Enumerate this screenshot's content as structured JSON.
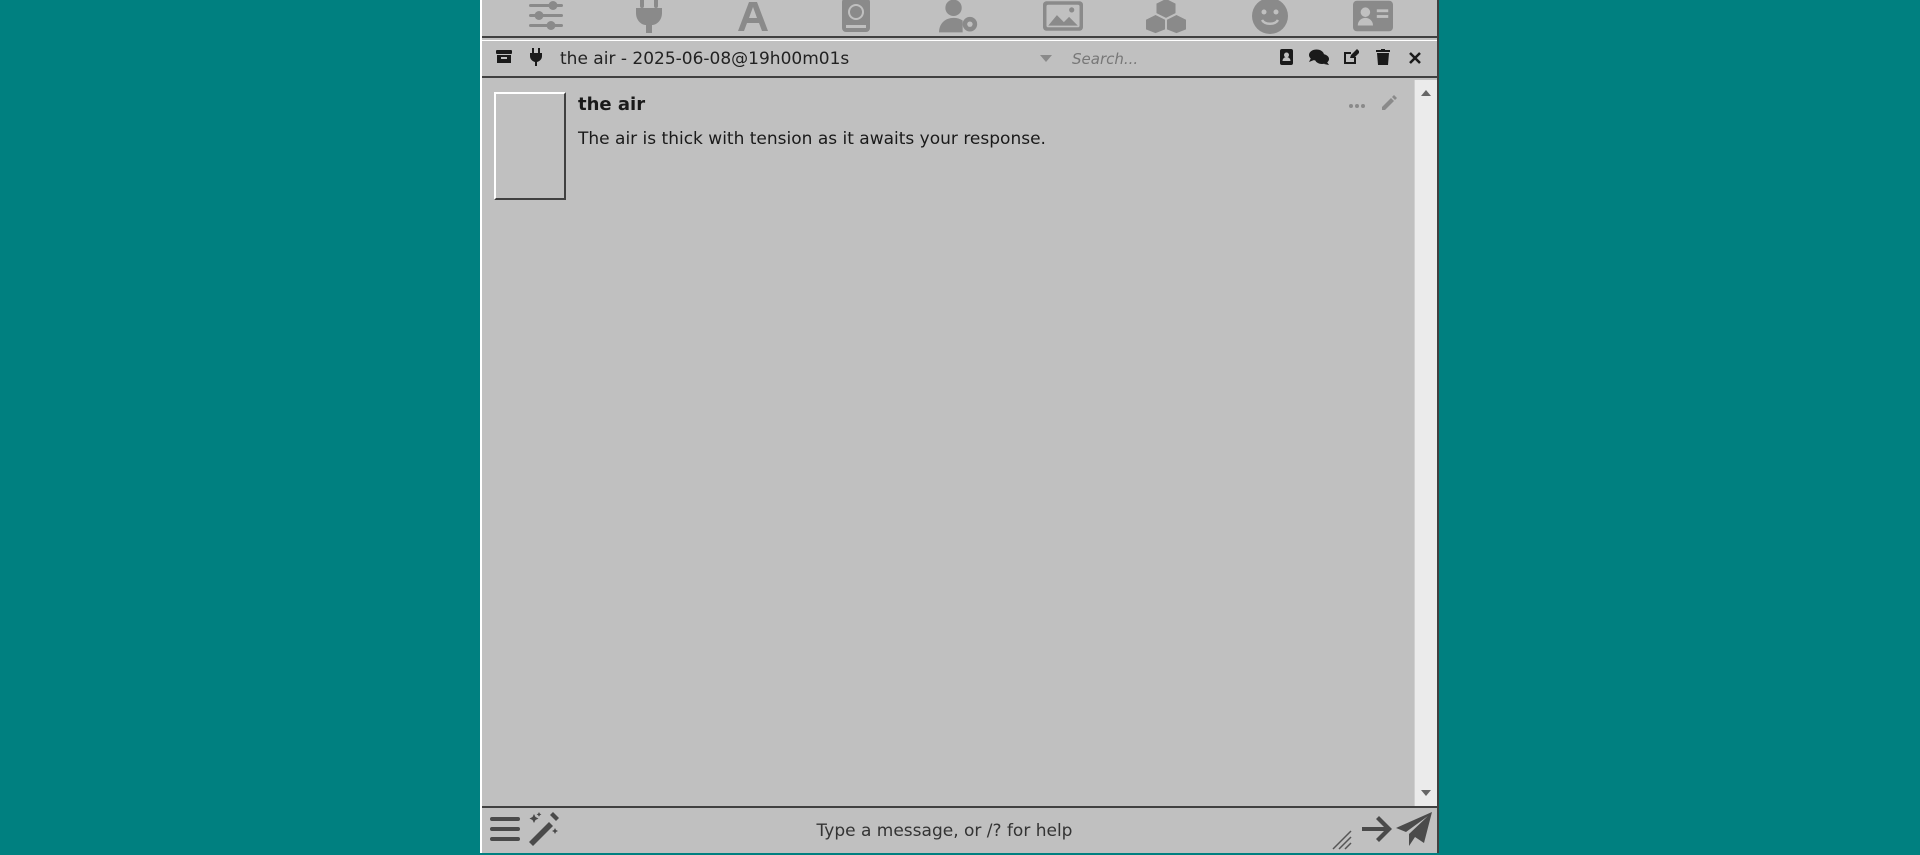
{
  "topbar": {
    "icons": [
      "sliders-icon",
      "plug-icon",
      "font-icon",
      "book-atlas-icon",
      "user-gear-icon",
      "image-icon",
      "cubes-icon",
      "smile-icon",
      "address-card-icon"
    ]
  },
  "chat_header": {
    "title": "the air - 2025-06-08@19h00m01s",
    "search_placeholder": "Search..."
  },
  "messages": [
    {
      "name": "the air",
      "text": "The air is thick with tension as it awaits your response."
    }
  ],
  "input": {
    "placeholder": "Type a message, or /? for help",
    "value": ""
  },
  "colors": {
    "desktop": "#008080",
    "panel": "#c0c0c0",
    "icon_muted": "#8a8a8a"
  }
}
